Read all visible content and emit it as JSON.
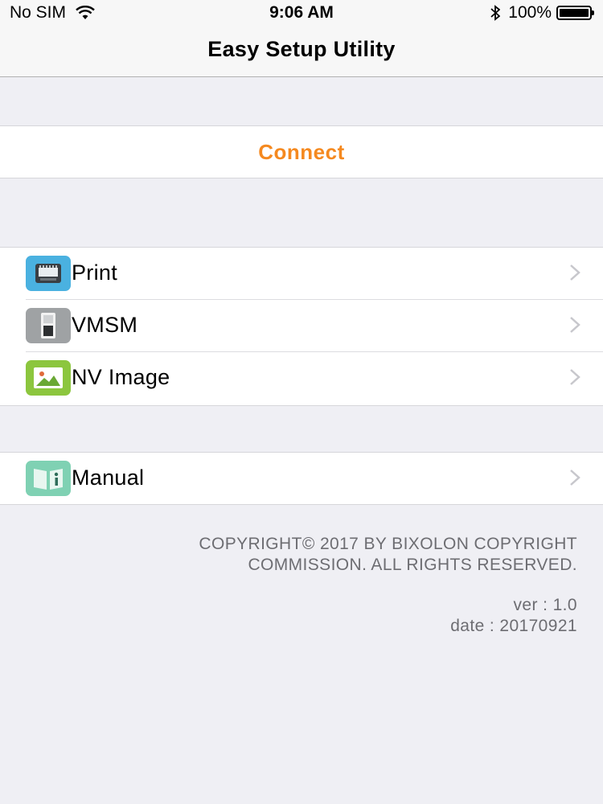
{
  "status_bar": {
    "carrier": "No SIM",
    "time": "9:06 AM",
    "battery_percent": "100%",
    "battery_level": 1.0,
    "icons": [
      "wifi-icon",
      "bluetooth-icon",
      "battery-icon"
    ]
  },
  "nav": {
    "title": "Easy Setup Utility"
  },
  "connect": {
    "label": "Connect",
    "color": "#f5891f"
  },
  "menu": {
    "items": [
      {
        "label": "Print",
        "icon": "printer-icon",
        "icon_color": "#4ab1e0"
      },
      {
        "label": "VMSM",
        "icon": "switch-icon",
        "icon_color": "#9fa2a4"
      },
      {
        "label": "NV Image",
        "icon": "image-icon",
        "icon_color": "#8cc63e"
      }
    ]
  },
  "manual": {
    "label": "Manual",
    "icon": "book-info-icon",
    "icon_color": "#7fd1b3"
  },
  "footer": {
    "copyright": "COPYRIGHT© 2017 BY BIXOLON COPYRIGHT COMMISSION. ALL RIGHTS RESERVED.",
    "version": "ver : 1.0",
    "date": "date : 20170921"
  }
}
